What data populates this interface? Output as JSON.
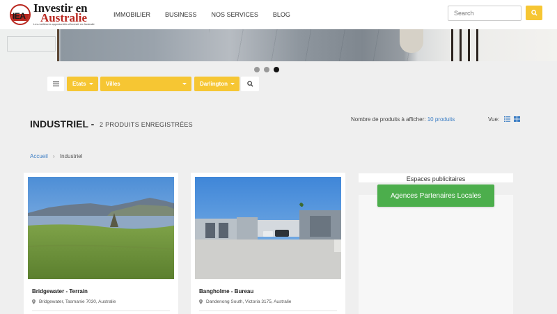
{
  "logo": {
    "line1": "Investir en",
    "line2": "Australie",
    "badge": "IEA",
    "tagline": "Les meilleures opportunités d'investir en Australie"
  },
  "nav": {
    "items": [
      {
        "label": "IMMOBILIER"
      },
      {
        "label": "BUSINESS"
      },
      {
        "label": "NOS SERVICES"
      },
      {
        "label": "BLOG"
      }
    ]
  },
  "search": {
    "placeholder": "Search",
    "icon": "search-icon"
  },
  "carousel": {
    "slide_count": 3,
    "active_index": 2
  },
  "filters": {
    "menu_icon": "hamburger-icon",
    "states_label": "Etats",
    "cities_label": "Villes",
    "suburb_label": "Darlington",
    "search_icon": "search-icon"
  },
  "page": {
    "title": "INDUSTRIEL -",
    "subtitle": "2 PRODUITS ENREGISTRÉES",
    "count_label": "Nombre de produits à afficher:",
    "count_value": "10 produits",
    "view_label": "Vue:"
  },
  "breadcrumb": {
    "home": "Accueil",
    "current": "Industriel"
  },
  "listings": [
    {
      "title": "Bridgewater - Terrain",
      "address": "Bridgewater, Tasmanie 7030, Australie"
    },
    {
      "title": "Bangholme - Bureau",
      "address": "Dandenong South, Victoria 3175, Australie"
    }
  ],
  "ads": {
    "heading": "Espaces publicitaires",
    "partner_button": "Agences Partenaires Locales"
  },
  "colors": {
    "accent": "#f6c633",
    "link": "#3b7dc4",
    "brand_red": "#b9271f",
    "partner_green": "#4cae4c"
  }
}
